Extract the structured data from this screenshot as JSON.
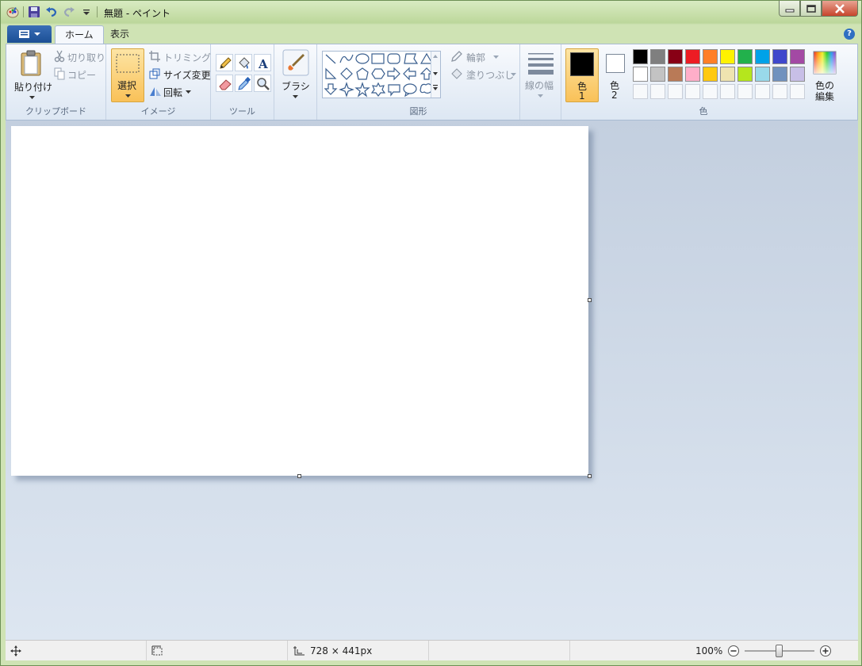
{
  "window": {
    "title": "無題 - ペイント"
  },
  "quick_access": {
    "icons": [
      "paint-app-icon",
      "save-icon",
      "undo-icon",
      "redo-icon",
      "customize-dropdown-icon"
    ]
  },
  "tabs": {
    "home": "ホーム",
    "view": "表示"
  },
  "clipboard": {
    "paste": "貼り付け",
    "cut": "切り取り",
    "copy": "コピー",
    "group": "クリップボード"
  },
  "image": {
    "select": "選択",
    "crop": "トリミング",
    "resize": "サイズ変更",
    "rotate": "回転",
    "group": "イメージ"
  },
  "tools": {
    "group": "ツール"
  },
  "brush": {
    "label": "ブラシ"
  },
  "shapes": {
    "outline": "輪郭",
    "fill": "塗りつぶし",
    "group": "図形"
  },
  "line_width": {
    "label": "線の幅"
  },
  "colors": {
    "color1_label_a": "色",
    "color1_label_b": "1",
    "color2_label_a": "色",
    "color2_label_b": "2",
    "edit_a": "色の",
    "edit_b": "編集",
    "group": "色",
    "color1": "#000000",
    "color2": "#ffffff",
    "palette_row1": [
      "#000000",
      "#7f7f7f",
      "#880015",
      "#ed1c24",
      "#ff7f27",
      "#fff200",
      "#22b14c",
      "#00a2e8",
      "#3f48cc",
      "#a349a4"
    ],
    "palette_row2": [
      "#ffffff",
      "#c3c3c3",
      "#b97a57",
      "#ffaec9",
      "#ffc90e",
      "#efe4b0",
      "#b5e61d",
      "#99d9ea",
      "#7092be",
      "#c8bfe7"
    ]
  },
  "status": {
    "size": "728 × 441px",
    "zoom": "100%",
    "zoom_level": 1.0
  }
}
